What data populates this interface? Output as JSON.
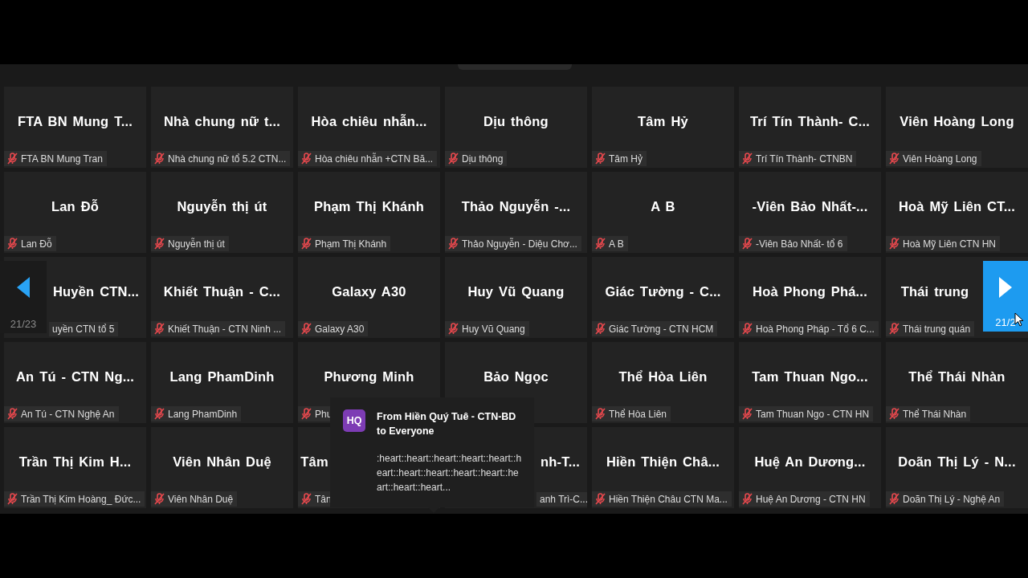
{
  "gallery": {
    "rows": [
      [
        {
          "name": "FTA BN Mung T...",
          "label": "FTA BN Mung Tran",
          "muted": true
        },
        {
          "name": "Nhà chung nữ t...",
          "label": "Nhà chung nữ tổ 5.2 CTN...",
          "muted": true
        },
        {
          "name": "Hòa chiêu nhẫn...",
          "label": "Hòa chiêu nhẫn +CTN Bă...",
          "muted": true
        },
        {
          "name": "Dịu thông",
          "label": "Dịu thông",
          "muted": true
        },
        {
          "name": "Tâm Hỷ",
          "label": "Tâm Hỷ",
          "muted": true
        },
        {
          "name": "Trí Tín Thành- C...",
          "label": "Trí Tín Thành- CTNBN",
          "muted": true
        },
        {
          "name": "Viên Hoàng Long",
          "label": "Viên Hoàng Long",
          "muted": true
        }
      ],
      [
        {
          "name": "Lan Đỗ",
          "label": "Lan Đỗ",
          "muted": true
        },
        {
          "name": "Nguyễn thị út",
          "label": "Nguyễn thị út",
          "muted": true
        },
        {
          "name": "Phạm Thị Khánh",
          "label": "Phạm Thị Khánh",
          "muted": true
        },
        {
          "name": "Thảo Nguyễn -...",
          "label": "Thảo Nguyễn - Diệu Chơ...",
          "muted": true
        },
        {
          "name": "A B",
          "label": "A B",
          "muted": true
        },
        {
          "name": "-Viên Bảo Nhất-...",
          "label": "-Viên Bảo Nhất- tổ 6",
          "muted": true
        },
        {
          "name": "Hoà Mỹ Liên CT...",
          "label": "Hoà Mỹ Liên CTN HN",
          "muted": true
        }
      ],
      [
        {
          "name": "Huyền CTN...",
          "label": "uyền CTN tổ 5"
        },
        {
          "name": "Khiết Thuận - C...",
          "label": "Khiết Thuận - CTN Ninh ...",
          "muted": true
        },
        {
          "name": "Galaxy A30",
          "label": "Galaxy A30",
          "muted": true
        },
        {
          "name": "Huy Vũ Quang",
          "label": "Huy Vũ Quang",
          "muted": true
        },
        {
          "name": "Giác Tường - C...",
          "label": "Giác Tường - CTN HCM",
          "muted": true
        },
        {
          "name": "Hoà Phong Phá...",
          "label": "Hoà Phong Pháp - Tổ 6 C...",
          "muted": true
        },
        {
          "name": "Thái trung",
          "label": "Thái trung quán",
          "muted": true
        }
      ],
      [
        {
          "name": "An Tú - CTN Ng...",
          "label": "An Tú - CTN Nghệ An",
          "muted": true
        },
        {
          "name": "Lang PhamDinh",
          "label": "Lang PhamDinh",
          "muted": true
        },
        {
          "name": "Phương Minh",
          "label": "Phu",
          "muted": true
        },
        {
          "name": "Bảo Ngọc"
        },
        {
          "name": "Thể Hòa Liên",
          "label": "Thể Hòa Liên",
          "muted": true
        },
        {
          "name": "Tam Thuan Ngo...",
          "label": "Tam Thuan Ngo - CTN HN",
          "muted": true
        },
        {
          "name": "Thể Thái Nhàn",
          "label": "Thể Thái Nhàn",
          "muted": true
        }
      ],
      [
        {
          "name": "Trần Thị Kim H...",
          "label": "Trần Thị Kim Hoàng_ Đức...",
          "muted": true
        },
        {
          "name": "Viên Nhân Duệ",
          "label": "Viên Nhân Duệ",
          "muted": true
        },
        {
          "name": "Tâm",
          "label": "Tân",
          "muted": true
        },
        {
          "name": "nh-T...",
          "label": "anh Trì-C..."
        },
        {
          "name": "Hiền Thiện Châ...",
          "label": "Hiền Thiện Châu CTN Ma...",
          "muted": true
        },
        {
          "name": "Huệ An Dương...",
          "label": "Huệ An Dương - CTN HN",
          "muted": true
        },
        {
          "name": "Doãn Thị Lý - N...",
          "label": "Doãn Thị Lý - Nghệ An",
          "muted": true
        }
      ]
    ]
  },
  "prev_page": {
    "counter": "21/23"
  },
  "next_page": {
    "counter": "21/2"
  },
  "chat_popup": {
    "avatar": "HQ",
    "title": "From Hiền Quý Tuê - CTN-BD to Everyone",
    "message": ":heart::heart::heart::heart::heart::heart::heart::heart::heart::heart::heart::heart::heart..."
  }
}
